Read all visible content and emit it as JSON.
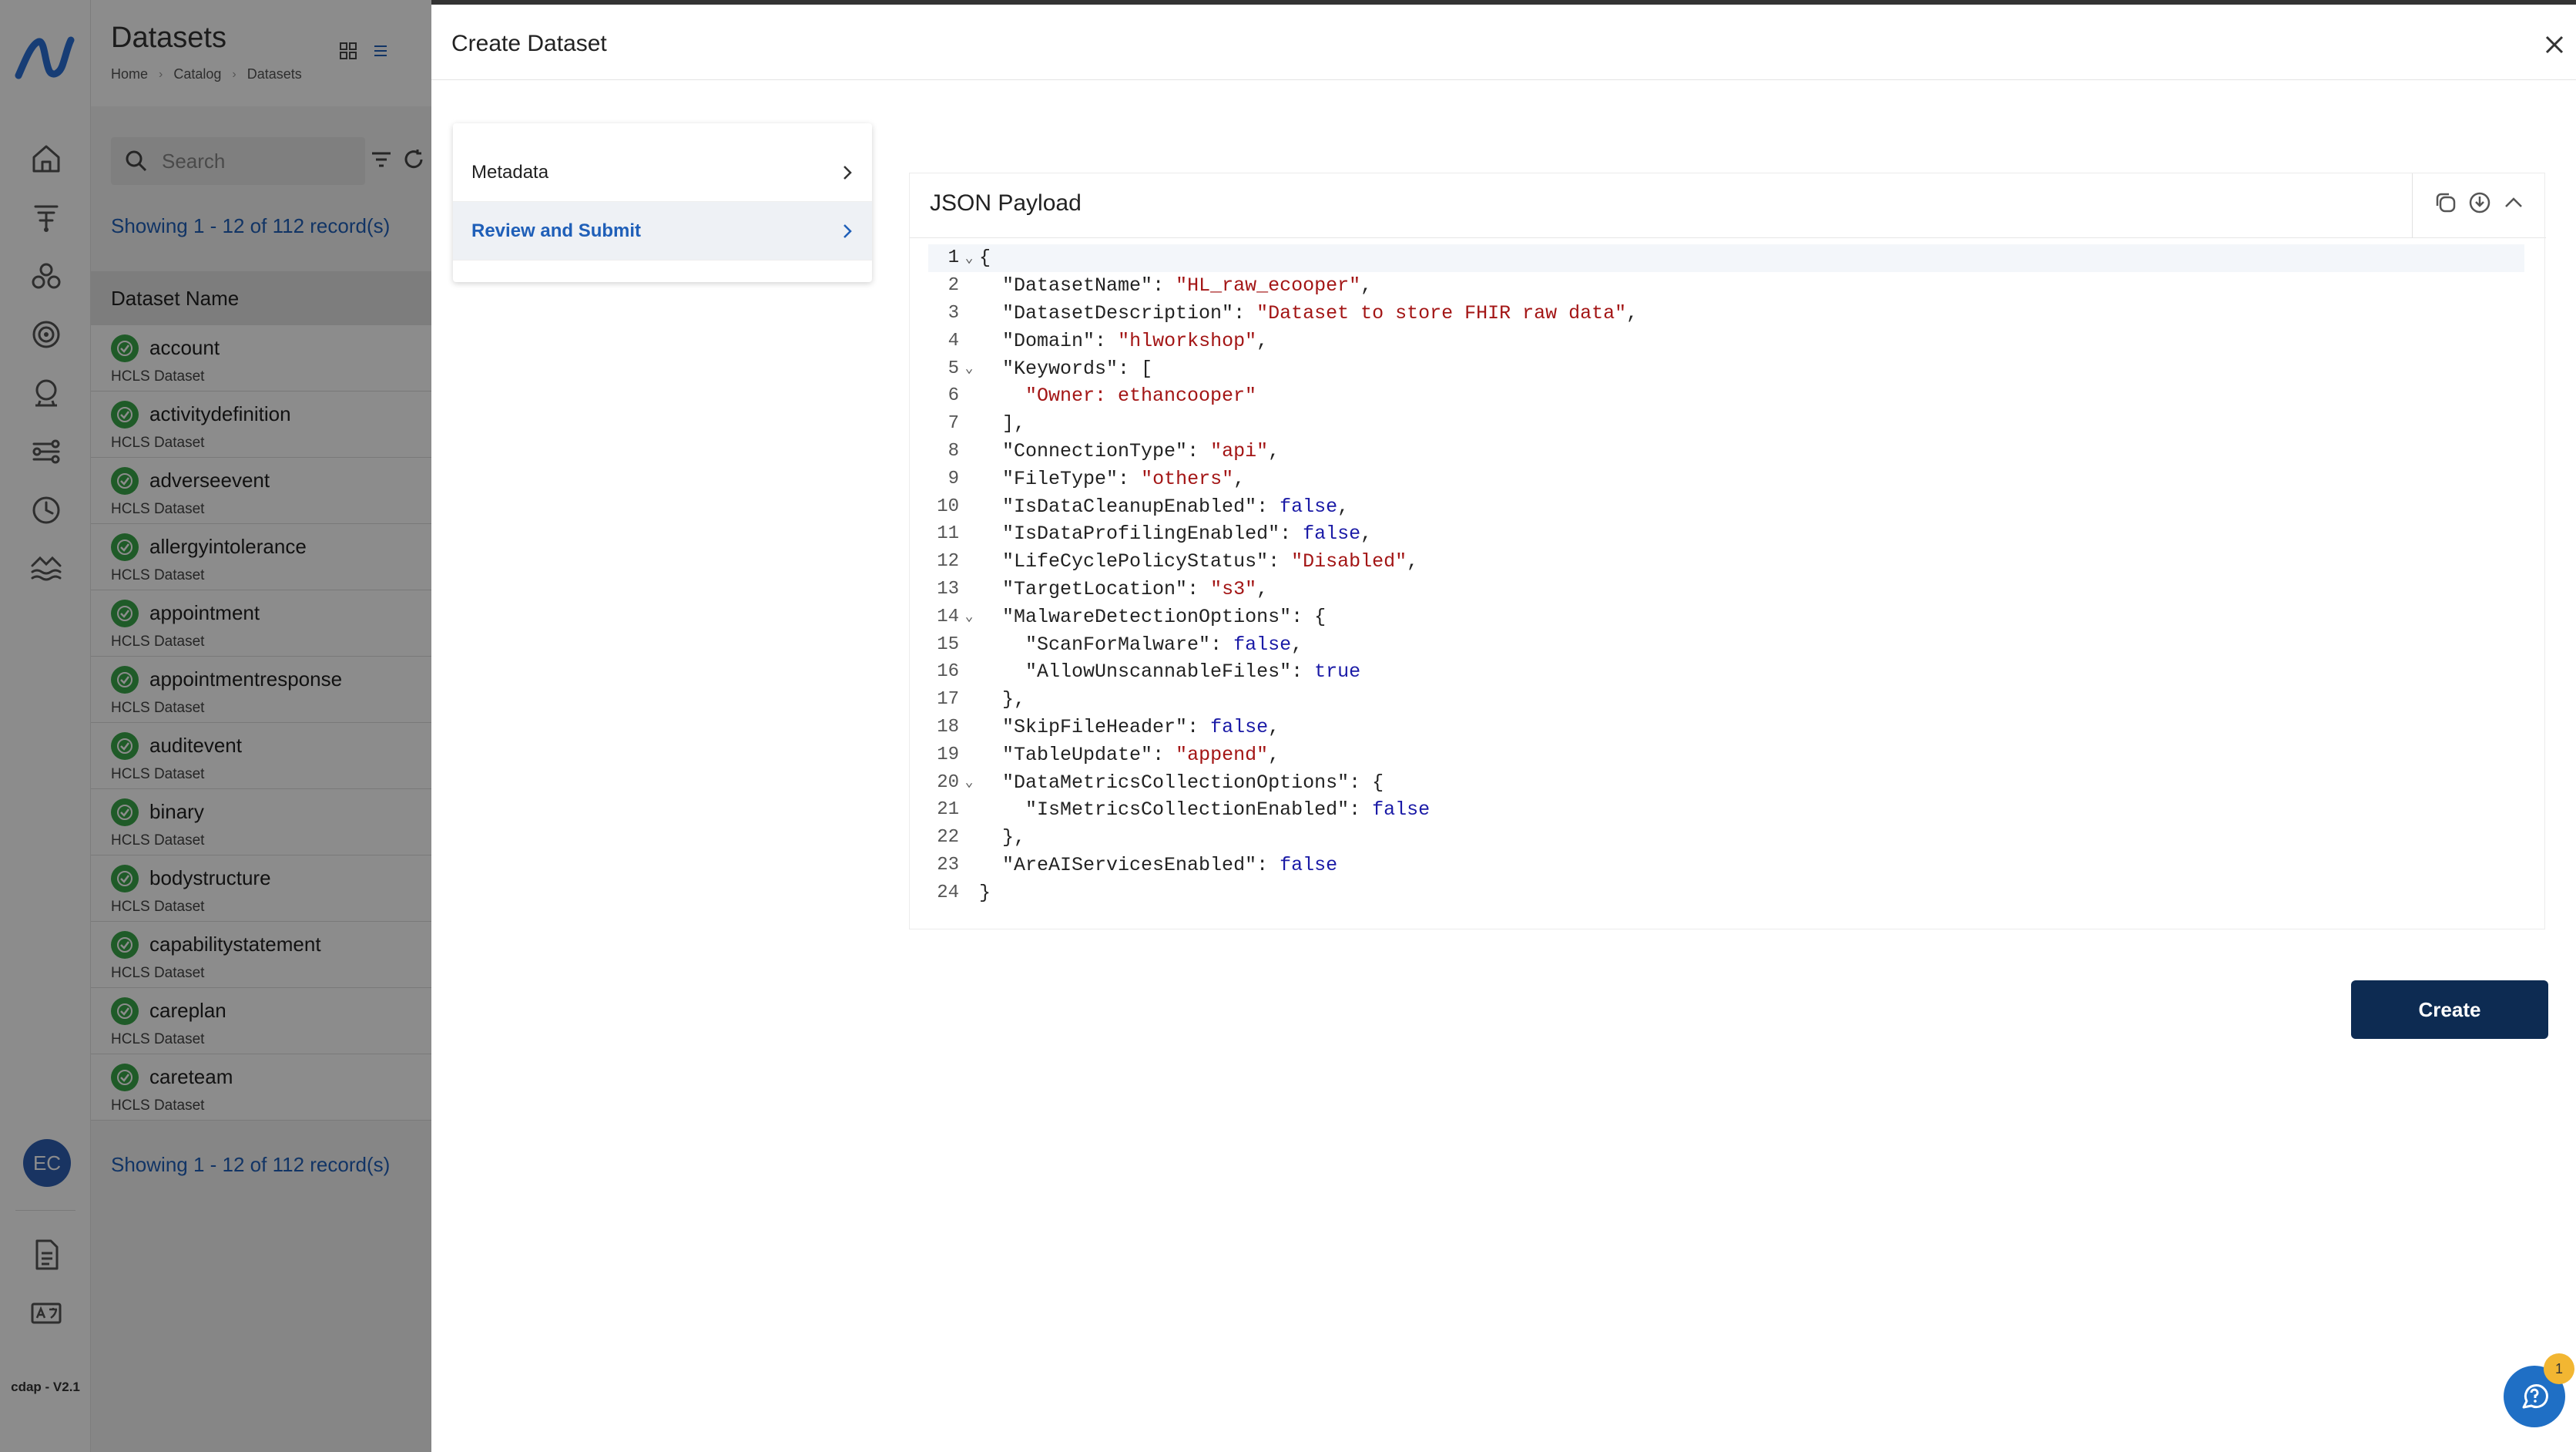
{
  "app": {
    "version": "cdap - V2.1",
    "user_initials": "EC"
  },
  "list_panel": {
    "title": "Datasets",
    "breadcrumb": [
      "Home",
      "Catalog",
      "Datasets"
    ],
    "search_placeholder": "Search",
    "showing_text": "Showing 1 - 12 of 112 record(s)",
    "column_header": "Dataset Name",
    "rows": [
      {
        "name": "account",
        "sub": "HCLS Dataset"
      },
      {
        "name": "activitydefinition",
        "sub": "HCLS Dataset"
      },
      {
        "name": "adverseevent",
        "sub": "HCLS Dataset"
      },
      {
        "name": "allergyintolerance",
        "sub": "HCLS Dataset"
      },
      {
        "name": "appointment",
        "sub": "HCLS Dataset"
      },
      {
        "name": "appointmentresponse",
        "sub": "HCLS Dataset"
      },
      {
        "name": "auditevent",
        "sub": "HCLS Dataset"
      },
      {
        "name": "binary",
        "sub": "HCLS Dataset"
      },
      {
        "name": "bodystructure",
        "sub": "HCLS Dataset"
      },
      {
        "name": "capabilitystatement",
        "sub": "HCLS Dataset"
      },
      {
        "name": "careplan",
        "sub": "HCLS Dataset"
      },
      {
        "name": "careteam",
        "sub": "HCLS Dataset"
      }
    ]
  },
  "drawer": {
    "title": "Create Dataset",
    "steps": [
      {
        "label": "Metadata",
        "active": false
      },
      {
        "label": "Review and Submit",
        "active": true
      }
    ],
    "json_payload_title": "JSON Payload",
    "create_label": "Create",
    "code_lines": [
      {
        "n": "1",
        "fold": true,
        "parts": [
          [
            "p",
            "{"
          ]
        ]
      },
      {
        "n": "2",
        "fold": false,
        "parts": [
          [
            "p",
            "  "
          ],
          [
            "k",
            "\"DatasetName\""
          ],
          [
            "p",
            ": "
          ],
          [
            "s",
            "\"HL_raw_ecooper\""
          ],
          [
            "p",
            ","
          ]
        ]
      },
      {
        "n": "3",
        "fold": false,
        "parts": [
          [
            "p",
            "  "
          ],
          [
            "k",
            "\"DatasetDescription\""
          ],
          [
            "p",
            ": "
          ],
          [
            "s",
            "\"Dataset to store FHIR raw data\""
          ],
          [
            "p",
            ","
          ]
        ]
      },
      {
        "n": "4",
        "fold": false,
        "parts": [
          [
            "p",
            "  "
          ],
          [
            "k",
            "\"Domain\""
          ],
          [
            "p",
            ": "
          ],
          [
            "s",
            "\"hlworkshop\""
          ],
          [
            "p",
            ","
          ]
        ]
      },
      {
        "n": "5",
        "fold": true,
        "parts": [
          [
            "p",
            "  "
          ],
          [
            "k",
            "\"Keywords\""
          ],
          [
            "p",
            ": ["
          ]
        ]
      },
      {
        "n": "6",
        "fold": false,
        "parts": [
          [
            "p",
            "    "
          ],
          [
            "s",
            "\"Owner: ethancooper\""
          ]
        ]
      },
      {
        "n": "7",
        "fold": false,
        "parts": [
          [
            "p",
            "  ],"
          ]
        ]
      },
      {
        "n": "8",
        "fold": false,
        "parts": [
          [
            "p",
            "  "
          ],
          [
            "k",
            "\"ConnectionType\""
          ],
          [
            "p",
            ": "
          ],
          [
            "s",
            "\"api\""
          ],
          [
            "p",
            ","
          ]
        ]
      },
      {
        "n": "9",
        "fold": false,
        "parts": [
          [
            "p",
            "  "
          ],
          [
            "k",
            "\"FileType\""
          ],
          [
            "p",
            ": "
          ],
          [
            "s",
            "\"others\""
          ],
          [
            "p",
            ","
          ]
        ]
      },
      {
        "n": "10",
        "fold": false,
        "parts": [
          [
            "p",
            "  "
          ],
          [
            "k",
            "\"IsDataCleanupEnabled\""
          ],
          [
            "p",
            ": "
          ],
          [
            "b",
            "false"
          ],
          [
            "p",
            ","
          ]
        ]
      },
      {
        "n": "11",
        "fold": false,
        "parts": [
          [
            "p",
            "  "
          ],
          [
            "k",
            "\"IsDataProfilingEnabled\""
          ],
          [
            "p",
            ": "
          ],
          [
            "b",
            "false"
          ],
          [
            "p",
            ","
          ]
        ]
      },
      {
        "n": "12",
        "fold": false,
        "parts": [
          [
            "p",
            "  "
          ],
          [
            "k",
            "\"LifeCyclePolicyStatus\""
          ],
          [
            "p",
            ": "
          ],
          [
            "s",
            "\"Disabled\""
          ],
          [
            "p",
            ","
          ]
        ]
      },
      {
        "n": "13",
        "fold": false,
        "parts": [
          [
            "p",
            "  "
          ],
          [
            "k",
            "\"TargetLocation\""
          ],
          [
            "p",
            ": "
          ],
          [
            "s",
            "\"s3\""
          ],
          [
            "p",
            ","
          ]
        ]
      },
      {
        "n": "14",
        "fold": true,
        "parts": [
          [
            "p",
            "  "
          ],
          [
            "k",
            "\"MalwareDetectionOptions\""
          ],
          [
            "p",
            ": {"
          ]
        ]
      },
      {
        "n": "15",
        "fold": false,
        "parts": [
          [
            "p",
            "    "
          ],
          [
            "k",
            "\"ScanForMalware\""
          ],
          [
            "p",
            ": "
          ],
          [
            "b",
            "false"
          ],
          [
            "p",
            ","
          ]
        ]
      },
      {
        "n": "16",
        "fold": false,
        "parts": [
          [
            "p",
            "    "
          ],
          [
            "k",
            "\"AllowUnscannableFiles\""
          ],
          [
            "p",
            ": "
          ],
          [
            "b",
            "true"
          ]
        ]
      },
      {
        "n": "17",
        "fold": false,
        "parts": [
          [
            "p",
            "  },"
          ]
        ]
      },
      {
        "n": "18",
        "fold": false,
        "parts": [
          [
            "p",
            "  "
          ],
          [
            "k",
            "\"SkipFileHeader\""
          ],
          [
            "p",
            ": "
          ],
          [
            "b",
            "false"
          ],
          [
            "p",
            ","
          ]
        ]
      },
      {
        "n": "19",
        "fold": false,
        "parts": [
          [
            "p",
            "  "
          ],
          [
            "k",
            "\"TableUpdate\""
          ],
          [
            "p",
            ": "
          ],
          [
            "s",
            "\"append\""
          ],
          [
            "p",
            ","
          ]
        ]
      },
      {
        "n": "20",
        "fold": true,
        "parts": [
          [
            "p",
            "  "
          ],
          [
            "k",
            "\"DataMetricsCollectionOptions\""
          ],
          [
            "p",
            ": {"
          ]
        ]
      },
      {
        "n": "21",
        "fold": false,
        "parts": [
          [
            "p",
            "    "
          ],
          [
            "k",
            "\"IsMetricsCollectionEnabled\""
          ],
          [
            "p",
            ": "
          ],
          [
            "b",
            "false"
          ]
        ]
      },
      {
        "n": "22",
        "fold": false,
        "parts": [
          [
            "p",
            "  },"
          ]
        ]
      },
      {
        "n": "23",
        "fold": false,
        "parts": [
          [
            "p",
            "  "
          ],
          [
            "k",
            "\"AreAIServicesEnabled\""
          ],
          [
            "p",
            ": "
          ],
          [
            "b",
            "false"
          ]
        ]
      },
      {
        "n": "24",
        "fold": false,
        "parts": [
          [
            "p",
            "}"
          ]
        ]
      }
    ]
  },
  "help": {
    "badge_count": "1"
  },
  "icons": {
    "rail": [
      "home-icon",
      "ingest-icon",
      "catalog-icon",
      "target-icon",
      "monitor-icon",
      "pipeline-icon",
      "clock-icon",
      "lake-icon",
      "document-icon",
      "translate-icon"
    ],
    "accent": "#1f5fb8",
    "primary_button": "#0d2b52",
    "success": "#3aa64a"
  }
}
